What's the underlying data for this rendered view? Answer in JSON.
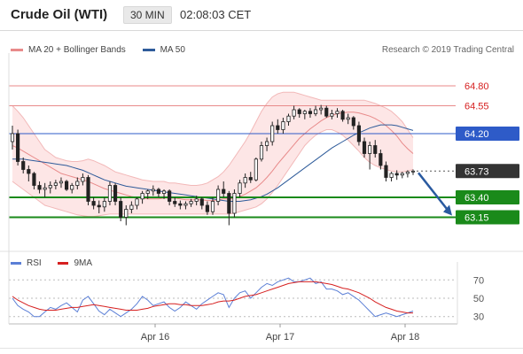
{
  "header": {
    "title": "Crude Oil (WTI)",
    "timeframe": "30 MIN",
    "time": "02:08:03 CET"
  },
  "legend": {
    "items": [
      {
        "label": "MA 20 + Bollinger Bands",
        "color": "#e88a8a"
      },
      {
        "label": "MA 50",
        "color": "#2e5b9a"
      }
    ],
    "credit": "Research © 2019 Trading Central"
  },
  "rsi_legend": {
    "items": [
      {
        "label": "RSI",
        "color": "#5b7fd6"
      },
      {
        "label": "9MA",
        "color": "#d62020"
      }
    ]
  },
  "colors": {
    "up_candle": "#ffffff",
    "down_candle": "#222222",
    "band_fill": "#fde3e3",
    "ma20": "#e88a8a",
    "ma50": "#2e5b9a",
    "resistance": "#e88a8a",
    "pivot": "#2e5bc8",
    "support": "#1a8a1a",
    "current": "#333333",
    "arrow": "#2a5aa0"
  },
  "chart_data": [
    {
      "type": "candlestick",
      "title": "Crude Oil (WTI)",
      "timeframe": "30 MIN",
      "x_tick_labels": [
        "Apr 16",
        "Apr 17",
        "Apr 18"
      ],
      "ylim": [
        62.9,
        65.1
      ],
      "candles": [
        [
          64.1,
          64.3,
          64.0,
          64.2
        ],
        [
          64.2,
          64.25,
          63.8,
          63.85
        ],
        [
          63.85,
          63.9,
          63.7,
          63.75
        ],
        [
          63.75,
          63.8,
          63.6,
          63.7
        ],
        [
          63.7,
          63.72,
          63.5,
          63.55
        ],
        [
          63.55,
          63.6,
          63.45,
          63.5
        ],
        [
          63.5,
          63.58,
          63.4,
          63.52
        ],
        [
          63.52,
          63.6,
          63.45,
          63.55
        ],
        [
          63.55,
          63.62,
          63.5,
          63.58
        ],
        [
          63.58,
          63.65,
          63.52,
          63.6
        ],
        [
          63.6,
          63.62,
          63.48,
          63.5
        ],
        [
          63.5,
          63.58,
          63.45,
          63.55
        ],
        [
          63.55,
          63.65,
          63.5,
          63.6
        ],
        [
          63.6,
          63.7,
          63.55,
          63.65
        ],
        [
          63.65,
          63.68,
          63.3,
          63.35
        ],
        [
          63.35,
          63.4,
          63.25,
          63.3
        ],
        [
          63.3,
          63.36,
          63.2,
          63.28
        ],
        [
          63.28,
          63.4,
          63.22,
          63.35
        ],
        [
          63.35,
          63.6,
          63.3,
          63.55
        ],
        [
          63.55,
          63.58,
          63.3,
          63.35
        ],
        [
          63.35,
          63.4,
          63.1,
          63.15
        ],
        [
          63.15,
          63.3,
          63.05,
          63.25
        ],
        [
          63.25,
          63.35,
          63.2,
          63.3
        ],
        [
          63.3,
          63.4,
          63.25,
          63.38
        ],
        [
          63.38,
          63.48,
          63.32,
          63.45
        ],
        [
          63.45,
          63.5,
          63.38,
          63.48
        ],
        [
          63.48,
          63.55,
          63.42,
          63.5
        ],
        [
          63.5,
          63.52,
          63.4,
          63.45
        ],
        [
          63.45,
          63.5,
          63.38,
          63.48
        ],
        [
          63.48,
          63.5,
          63.3,
          63.35
        ],
        [
          63.35,
          63.4,
          63.28,
          63.32
        ],
        [
          63.32,
          63.36,
          63.25,
          63.3
        ],
        [
          63.3,
          63.35,
          63.25,
          63.32
        ],
        [
          63.32,
          63.38,
          63.28,
          63.35
        ],
        [
          63.35,
          63.42,
          63.3,
          63.38
        ],
        [
          63.38,
          63.4,
          63.25,
          63.3
        ],
        [
          63.3,
          63.35,
          63.18,
          63.22
        ],
        [
          63.22,
          63.4,
          63.18,
          63.35
        ],
        [
          63.35,
          63.55,
          63.3,
          63.5
        ],
        [
          63.5,
          63.6,
          63.4,
          63.45
        ],
        [
          63.45,
          63.48,
          63.05,
          63.2
        ],
        [
          63.2,
          63.5,
          63.15,
          63.45
        ],
        [
          63.45,
          63.62,
          63.4,
          63.58
        ],
        [
          63.58,
          63.7,
          63.52,
          63.65
        ],
        [
          63.65,
          63.72,
          63.58,
          63.62
        ],
        [
          63.62,
          63.9,
          63.6,
          63.88
        ],
        [
          63.88,
          64.1,
          63.85,
          64.05
        ],
        [
          64.05,
          64.15,
          63.98,
          64.1
        ],
        [
          64.1,
          64.35,
          64.05,
          64.3
        ],
        [
          64.3,
          64.38,
          64.2,
          64.25
        ],
        [
          64.25,
          64.4,
          64.2,
          64.35
        ],
        [
          64.35,
          64.45,
          64.3,
          64.42
        ],
        [
          64.42,
          64.55,
          64.38,
          64.5
        ],
        [
          64.5,
          64.52,
          64.4,
          64.45
        ],
        [
          64.45,
          64.5,
          64.38,
          64.48
        ],
        [
          64.48,
          64.52,
          64.4,
          64.45
        ],
        [
          64.45,
          64.55,
          64.42,
          64.5
        ],
        [
          64.5,
          64.56,
          64.44,
          64.52
        ],
        [
          64.52,
          64.55,
          64.4,
          64.42
        ],
        [
          64.42,
          64.5,
          64.38,
          64.45
        ],
        [
          64.45,
          64.52,
          64.4,
          64.48
        ],
        [
          64.48,
          64.5,
          64.35,
          64.38
        ],
        [
          64.38,
          64.45,
          64.32,
          64.4
        ],
        [
          64.4,
          64.42,
          64.25,
          64.3
        ],
        [
          64.3,
          64.35,
          64.05,
          64.1
        ],
        [
          64.1,
          64.15,
          63.9,
          63.95
        ],
        [
          63.95,
          64.1,
          63.75,
          64.05
        ],
        [
          64.05,
          64.12,
          63.9,
          63.95
        ],
        [
          63.95,
          64.0,
          63.75,
          63.8
        ],
        [
          63.8,
          63.85,
          63.6,
          63.65
        ],
        [
          63.65,
          63.72,
          63.6,
          63.7
        ],
        [
          63.7,
          63.74,
          63.62,
          63.68
        ],
        [
          63.68,
          63.72,
          63.64,
          63.7
        ],
        [
          63.7,
          63.74,
          63.65,
          63.72
        ],
        [
          63.72,
          63.75,
          63.68,
          63.73
        ]
      ],
      "ma20": [
        64.05,
        64.02,
        63.98,
        63.94,
        63.9,
        63.86,
        63.82,
        63.78,
        63.74,
        63.7,
        63.68,
        63.66,
        63.64,
        63.62,
        63.6,
        63.57,
        63.54,
        63.51,
        63.49,
        63.47,
        63.45,
        63.43,
        63.41,
        63.4,
        63.39,
        63.38,
        63.38,
        63.38,
        63.39,
        63.39,
        63.39,
        63.38,
        63.37,
        63.37,
        63.37,
        63.37,
        63.36,
        63.36,
        63.37,
        63.38,
        63.38,
        63.39,
        63.41,
        63.44,
        63.48,
        63.52,
        63.58,
        63.65,
        63.73,
        63.82,
        63.9,
        63.98,
        64.06,
        64.14,
        64.2,
        64.26,
        64.31,
        64.36,
        64.4,
        64.43,
        64.45,
        64.46,
        64.47,
        64.47,
        64.46,
        64.44,
        64.42,
        64.39,
        64.35,
        64.3,
        64.24,
        64.17,
        64.08,
        64.01,
        63.95
      ],
      "bb_upper": [
        64.55,
        64.48,
        64.4,
        64.3,
        64.2,
        64.1,
        64.0,
        63.95,
        63.9,
        63.88,
        63.86,
        63.85,
        63.85,
        63.86,
        63.88,
        63.86,
        63.83,
        63.8,
        63.76,
        63.72,
        63.7,
        63.68,
        63.66,
        63.64,
        63.62,
        63.61,
        63.6,
        63.6,
        63.6,
        63.58,
        63.58,
        63.57,
        63.56,
        63.55,
        63.55,
        63.56,
        63.58,
        63.62,
        63.66,
        63.72,
        63.8,
        63.9,
        64.0,
        64.1,
        64.22,
        64.35,
        64.48,
        64.58,
        64.66,
        64.7,
        64.72,
        64.72,
        64.72,
        64.7,
        64.68,
        64.66,
        64.64,
        64.62,
        64.62,
        64.62,
        64.62,
        64.62,
        64.62,
        64.62,
        64.62,
        64.62,
        64.6,
        64.58,
        64.55,
        64.52,
        64.48,
        64.42,
        64.35,
        64.25,
        64.15
      ],
      "bb_lower": [
        63.6,
        63.55,
        63.5,
        63.45,
        63.4,
        63.35,
        63.3,
        63.28,
        63.26,
        63.24,
        63.22,
        63.2,
        63.18,
        63.17,
        63.16,
        63.16,
        63.17,
        63.18,
        63.19,
        63.19,
        63.19,
        63.19,
        63.19,
        63.19,
        63.19,
        63.19,
        63.19,
        63.19,
        63.19,
        63.19,
        63.19,
        63.19,
        63.19,
        63.19,
        63.19,
        63.19,
        63.19,
        63.19,
        63.19,
        63.19,
        63.19,
        63.2,
        63.22,
        63.24,
        63.26,
        63.28,
        63.32,
        63.38,
        63.46,
        63.55,
        63.65,
        63.75,
        63.85,
        63.95,
        64.05,
        64.12,
        64.18,
        64.22,
        64.25,
        64.25,
        64.22,
        64.18,
        64.12,
        64.05,
        63.98,
        63.9,
        63.84,
        63.8,
        63.77,
        63.75,
        63.73,
        63.72,
        63.72,
        63.73,
        63.75
      ],
      "ma50": [
        63.88,
        63.88,
        63.88,
        63.87,
        63.86,
        63.85,
        63.84,
        63.83,
        63.82,
        63.81,
        63.8,
        63.78,
        63.76,
        63.74,
        63.71,
        63.68,
        63.65,
        63.62,
        63.6,
        63.58,
        63.56,
        63.54,
        63.53,
        63.52,
        63.51,
        63.5,
        63.49,
        63.48,
        63.47,
        63.46,
        63.45,
        63.44,
        63.43,
        63.42,
        63.41,
        63.4,
        63.39,
        63.38,
        63.37,
        63.36,
        63.35,
        63.35,
        63.35,
        63.36,
        63.37,
        63.39,
        63.41,
        63.44,
        63.48,
        63.52,
        63.57,
        63.62,
        63.67,
        63.72,
        63.77,
        63.82,
        63.87,
        63.92,
        63.97,
        64.02,
        64.06,
        64.1,
        64.14,
        64.18,
        64.21,
        64.24,
        64.27,
        64.29,
        64.31,
        64.31,
        64.31,
        64.3,
        64.28,
        64.26,
        64.24
      ],
      "levels": [
        {
          "price": "64.80",
          "kind": "resistance"
        },
        {
          "price": "64.55",
          "kind": "resistance"
        },
        {
          "price": "64.20",
          "kind": "pivot"
        },
        {
          "price": "63.73",
          "kind": "current"
        },
        {
          "price": "63.40",
          "kind": "support"
        },
        {
          "price": "63.15",
          "kind": "support"
        }
      ],
      "forecast_arrow": {
        "from": 63.73,
        "to": 63.15,
        "direction": "down"
      }
    },
    {
      "type": "line",
      "title": "RSI",
      "ylim": [
        22,
        78
      ],
      "y_tick_labels": [
        "70",
        "50",
        "30"
      ],
      "reference_lines": [
        70,
        50,
        30
      ],
      "series": [
        {
          "name": "RSI",
          "values": [
            50,
            42,
            38,
            35,
            30,
            30,
            35,
            40,
            38,
            42,
            45,
            40,
            35,
            48,
            52,
            44,
            36,
            32,
            38,
            34,
            30,
            34,
            38,
            44,
            52,
            48,
            42,
            44,
            46,
            40,
            36,
            40,
            46,
            42,
            38,
            44,
            48,
            52,
            56,
            54,
            40,
            50,
            56,
            58,
            50,
            56,
            62,
            66,
            64,
            68,
            70,
            72,
            68,
            68,
            70,
            72,
            66,
            68,
            60,
            60,
            58,
            54,
            56,
            52,
            48,
            42,
            36,
            30,
            32,
            34,
            32,
            30,
            32,
            34,
            36
          ]
        },
        {
          "name": "9MA",
          "values": [
            52,
            48,
            45,
            42,
            40,
            38,
            37,
            37,
            37,
            38,
            39,
            40,
            40,
            41,
            42,
            43,
            42,
            41,
            40,
            39,
            38,
            37,
            37,
            37,
            38,
            39,
            41,
            42,
            43,
            44,
            44,
            43,
            43,
            42,
            42,
            42,
            43,
            44,
            46,
            47,
            47,
            48,
            50,
            52,
            53,
            54,
            56,
            58,
            60,
            62,
            64,
            66,
            67,
            68,
            68,
            68,
            68,
            67,
            66,
            65,
            63,
            61,
            60,
            58,
            56,
            53,
            50,
            46,
            43,
            40,
            38,
            36,
            35,
            34,
            34
          ]
        }
      ]
    }
  ]
}
